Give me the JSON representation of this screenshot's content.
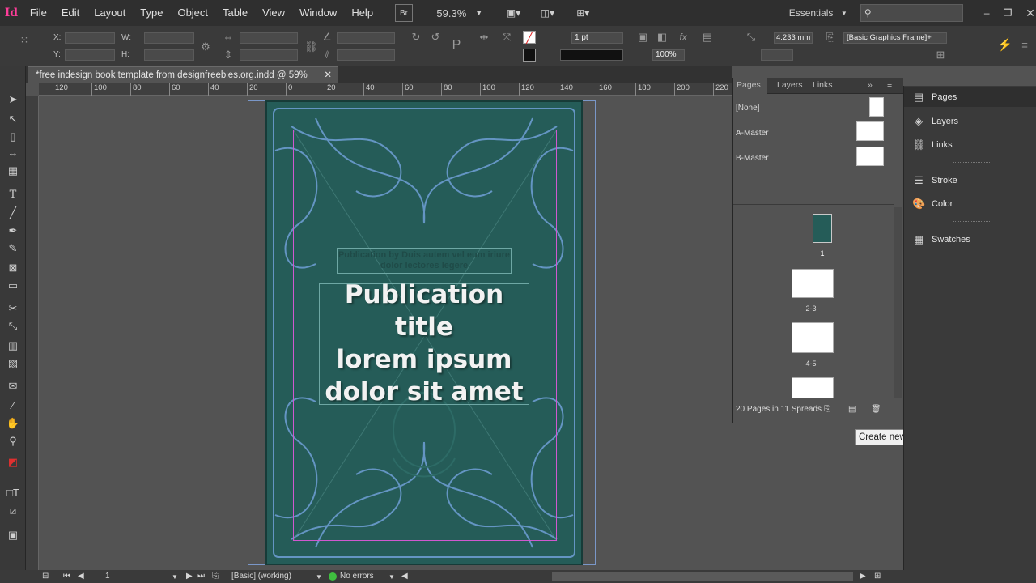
{
  "app": {
    "logo": "Id"
  },
  "menubar": {
    "items": [
      "File",
      "Edit",
      "Layout",
      "Type",
      "Object",
      "Table",
      "View",
      "Window",
      "Help"
    ],
    "bridge": "Br",
    "zoom": "59.3%",
    "workspace": "Essentials",
    "search_placeholder": ""
  },
  "control": {
    "x_label": "X:",
    "y_label": "Y:",
    "w_label": "W:",
    "h_label": "H:",
    "stroke_weight": "1 pt",
    "dimension": "4.233 mm",
    "opacity": "100%",
    "object_style": "[Basic Graphics Frame]+"
  },
  "document": {
    "tab_title": "*free indesign book template from designfreebies.org.indd @ 59%"
  },
  "ruler": {
    "h_ticks": [
      "120",
      "100",
      "80",
      "60",
      "40",
      "20",
      "0",
      "20",
      "40",
      "60",
      "80",
      "100",
      "120",
      "140",
      "160",
      "180",
      "200",
      "220"
    ]
  },
  "page_content": {
    "publication_by": "Publication by Duis autem vel eum iriure dolor lectores legere",
    "title_lines": [
      "Publication title",
      "lorem ipsum",
      "dolor sit amet"
    ]
  },
  "pages_panel": {
    "tabs": [
      "Pages",
      "Layers",
      "Links"
    ],
    "masters": [
      "[None]",
      "A-Master",
      "B-Master"
    ],
    "page_labels": [
      "1",
      "2-3",
      "4-5"
    ],
    "footer": "20 Pages in 11 Spreads",
    "tooltip": "Create new page"
  },
  "dock": {
    "items": [
      "Pages",
      "Layers",
      "Links",
      "Stroke",
      "Color",
      "Swatches"
    ]
  },
  "status": {
    "page": "1",
    "style": "[Basic] (working)",
    "errors": "No errors"
  },
  "colors": {
    "page_bg": "#255c58",
    "margin": "#d058d0",
    "bleed": "#7a97c8",
    "accent": "#ff3d9a",
    "error_ok": "#3fbf3f"
  }
}
